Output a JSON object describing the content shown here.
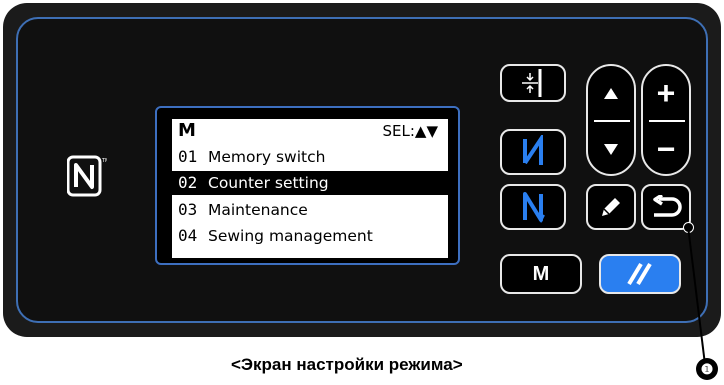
{
  "lcd": {
    "mode_letter": "M",
    "sel_label": "SEL:",
    "sel_arrows": "▲▼",
    "items": [
      {
        "no": "01",
        "label": "Memory switch"
      },
      {
        "no": "02",
        "label": "Counter setting"
      },
      {
        "no": "03",
        "label": "Maintenance"
      },
      {
        "no": "04",
        "label": "Sewing management"
      }
    ],
    "selected_index": 1
  },
  "buttons": {
    "m_label": "M",
    "plus_glyph": "+",
    "minus_glyph": "−"
  },
  "caption": "<Экран настройки режима>",
  "callout_number": "❶",
  "icons": [
    "nfc-icon",
    "needle-position-icon",
    "reverse-stitch-icon",
    "normal-stitch-icon",
    "up-arrow-icon",
    "down-arrow-icon",
    "plus-icon",
    "minus-icon",
    "pencil-icon",
    "return-icon",
    "reset-icon"
  ],
  "colors": {
    "accent": "#2a7ff0",
    "frame": "#3e6fb5"
  }
}
